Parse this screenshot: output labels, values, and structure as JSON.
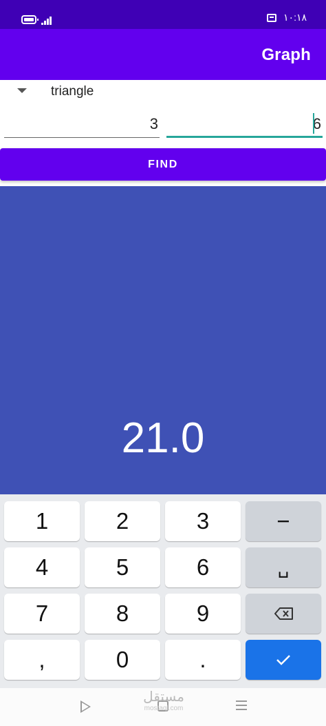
{
  "status_bar": {
    "time": "١٠:١٨"
  },
  "app_bar": {
    "title": "Graph"
  },
  "shape_selector": {
    "selected": "triangle"
  },
  "inputs": {
    "first_value": "3",
    "second_value": "6"
  },
  "find_button": {
    "label": "FIND"
  },
  "result": {
    "value": "21.0"
  },
  "keyboard": {
    "keys": [
      "1",
      "2",
      "3",
      "−",
      "4",
      "5",
      "6",
      "␣",
      "7",
      "8",
      "9",
      ",",
      "0",
      "."
    ]
  },
  "watermark": {
    "text": "مستقل",
    "sub": "mostaql.com"
  },
  "colors": {
    "status_bar": "#3f00b5",
    "app_bar": "#6200ee",
    "result_panel": "#3f51b5",
    "input_focus": "#26a69a",
    "enter_key": "#1a73e8"
  }
}
